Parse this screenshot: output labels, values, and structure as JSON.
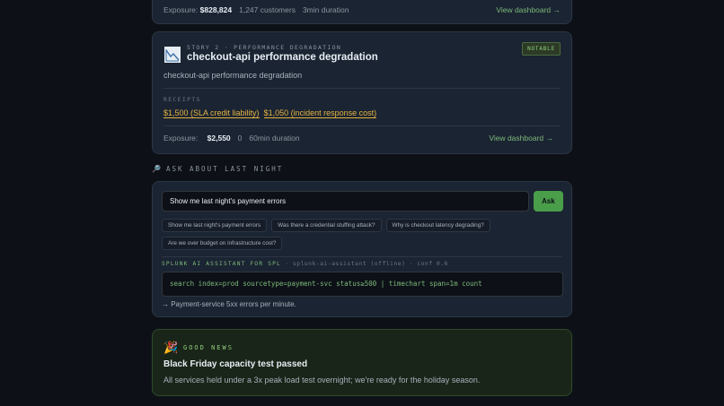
{
  "prev_story": {
    "exposure_label": "Exposure:",
    "exposure_value": "$828,824",
    "customers": "1,247 customers",
    "duration": "3min duration",
    "view_link": "View dashboard →"
  },
  "story": {
    "eyebrow": "STORY 2 · PERFORMANCE DEGRADATION",
    "title": "checkout-api performance degradation",
    "badge": "NOTABLE",
    "description": "checkout-api performance degradation",
    "receipts_label": "RECEIPTS",
    "receipts": [
      "$1,500 (SLA credit liability)",
      "$1,050 (incident response cost)"
    ],
    "exposure_label": "Exposure:",
    "exposure_value": "$2,550",
    "customers": "0",
    "duration": "60min duration",
    "view_link": "View dashboard →",
    "icon": "chart-image-icon"
  },
  "ask": {
    "heading": "ASK ABOUT LAST NIGHT",
    "heading_icon": "🔎",
    "input_value": "Show me last night's payment errors",
    "button_label": "Ask",
    "suggestions": [
      "Show me last night's payment errors",
      "Was there a credential stuffing attack?",
      "Why is checkout latency degrading?",
      "Are we over budget on infrastructure cost?"
    ],
    "spl_label_accent": "SPLUNK AI ASSISTANT FOR SPL",
    "spl_label_rest": " · splunk-ai-assistant (offline) · conf 0.6",
    "spl_query": "search index=prod sourcetype=payment-svc status≥500 | timechart span=1m count",
    "spl_explanation": "→ Payment-service 5xx errors per minute."
  },
  "good_news": {
    "icon": "🎉",
    "eyebrow": "GOOD NEWS",
    "title": "Black Friday capacity test passed",
    "description": "All services held under a 3x peak load test overnight; we're ready for the holiday season."
  },
  "colors": {
    "background": "#0d1117",
    "card": "#1b2432",
    "accent_green": "#7cb87a",
    "receipt_amber": "#e3b341",
    "ask_button": "#4a9e4a"
  }
}
